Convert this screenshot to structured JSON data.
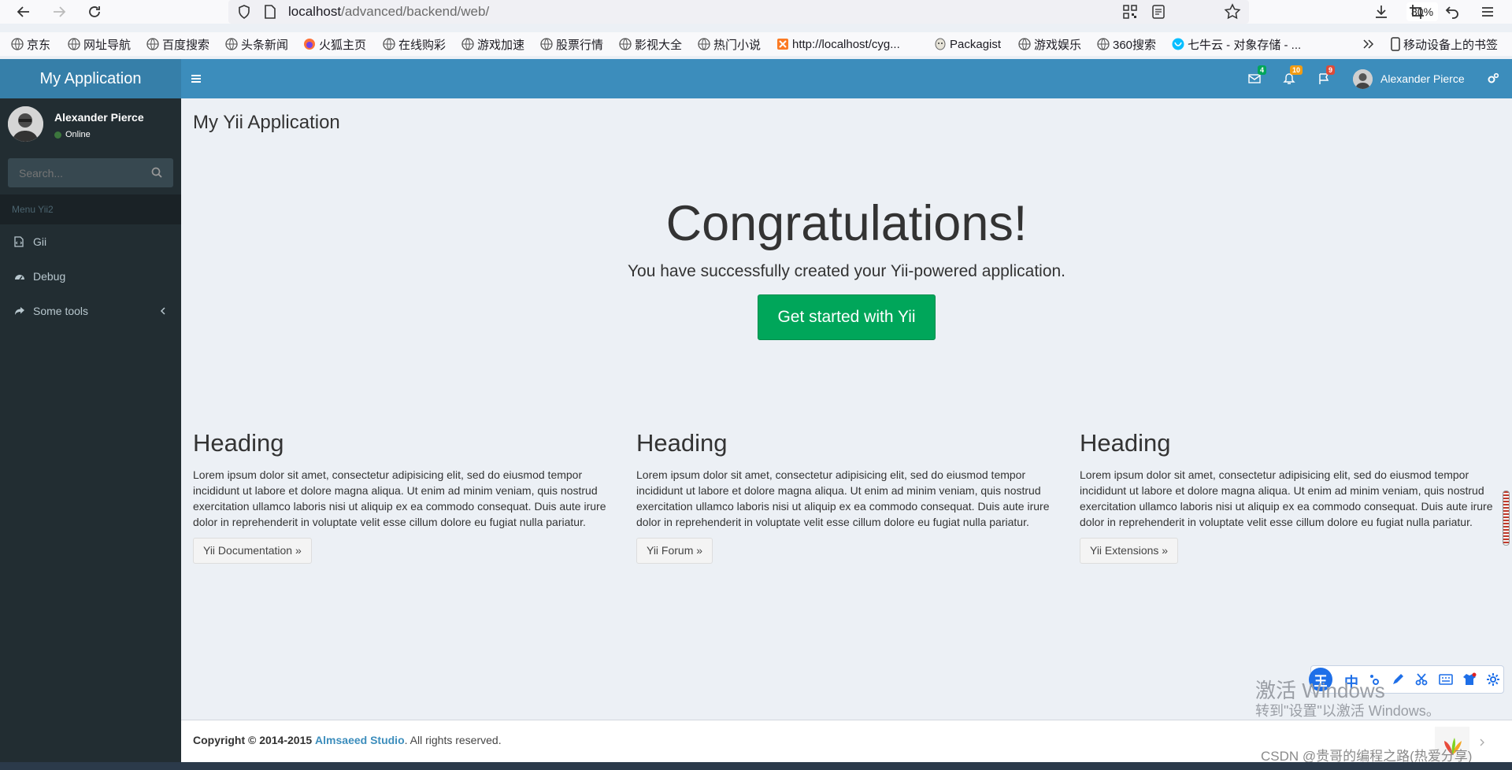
{
  "browser": {
    "url_host": "localhost",
    "url_path": "/advanced/backend/web/",
    "zoom": "80%",
    "bookmarks": [
      "京东",
      "网址导航",
      "百度搜索",
      "头条新闻",
      "火狐主页",
      "在线购彩",
      "游戏加速",
      "股票行情",
      "影视大全",
      "热门小说",
      "http://localhost/cyg...",
      "Packagist",
      "游戏娱乐",
      "360搜索",
      "七牛云 - 对象存储 - ..."
    ],
    "mobile_bookmarks": "移动设备上的书签"
  },
  "app": {
    "brand": "My Application",
    "user_name": "Alexander Pierce",
    "notifications": {
      "messages": "4",
      "alerts": "10",
      "flags": "9"
    }
  },
  "sidebar": {
    "user_name": "Alexander Pierce",
    "status": "Online",
    "search_placeholder": "Search...",
    "menu_header": "Menu Yii2",
    "items": [
      {
        "label": "Gii",
        "icon": "file-code-icon"
      },
      {
        "label": "Debug",
        "icon": "dashboard-icon"
      },
      {
        "label": "Some tools",
        "icon": "share-icon"
      }
    ]
  },
  "content": {
    "page_title": "My Yii Application",
    "jumbotron": {
      "heading": "Congratulations!",
      "lead": "You have successfully created your Yii-powered application.",
      "button": "Get started with Yii"
    },
    "columns": [
      {
        "heading": "Heading",
        "body": "Lorem ipsum dolor sit amet, consectetur adipisicing elit, sed do eiusmod tempor incididunt ut labore et dolore magna aliqua. Ut enim ad minim veniam, quis nostrud exercitation ullamco laboris nisi ut aliquip ex ea commodo consequat. Duis aute irure dolor in reprehenderit in voluptate velit esse cillum dolore eu fugiat nulla pariatur.",
        "button": "Yii Documentation »"
      },
      {
        "heading": "Heading",
        "body": "Lorem ipsum dolor sit amet, consectetur adipisicing elit, sed do eiusmod tempor incididunt ut labore et dolore magna aliqua. Ut enim ad minim veniam, quis nostrud exercitation ullamco laboris nisi ut aliquip ex ea commodo consequat. Duis aute irure dolor in reprehenderit in voluptate velit esse cillum dolore eu fugiat nulla pariatur.",
        "button": "Yii Forum »"
      },
      {
        "heading": "Heading",
        "body": "Lorem ipsum dolor sit amet, consectetur adipisicing elit, sed do eiusmod tempor incididunt ut labore et dolore magna aliqua. Ut enim ad minim veniam, quis nostrud exercitation ullamco laboris nisi ut aliquip ex ea commodo consequat. Duis aute irure dolor in reprehenderit in voluptate velit esse cillum dolore eu fugiat nulla pariatur.",
        "button": "Yii Extensions »"
      }
    ]
  },
  "footer": {
    "copyright": "Copyright © 2014-2015",
    "studio": "Almsaeed Studio",
    "suffix": ". All rights reserved."
  },
  "overlay": {
    "watermark_title": "激活 Windows",
    "watermark_sub": "转到\"设置\"以激活 Windows。",
    "csdn": "CSDN @贵哥的编程之路(热爱分享)"
  },
  "colors": {
    "brand_dark": "#367fa9",
    "brand": "#3c8dbc",
    "sidebar": "#222d32",
    "success": "#00a65a",
    "bg": "#ecf0f5"
  }
}
